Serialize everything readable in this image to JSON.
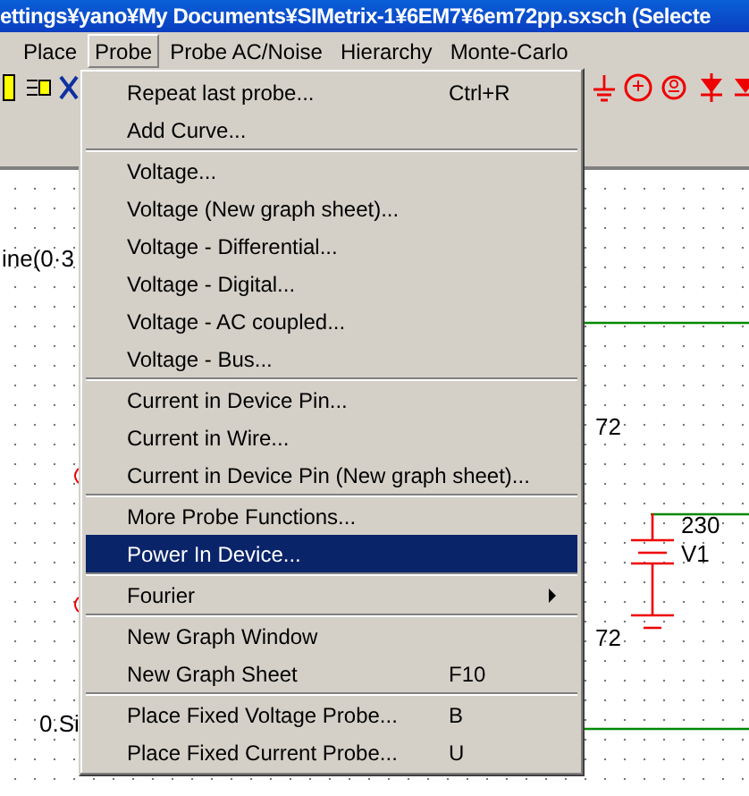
{
  "window": {
    "title": "ettings¥yano¥My Documents¥SIMetrix-1¥6EM7¥6em72pp.sxsch (Selecte"
  },
  "menubar": [
    {
      "label": "Place",
      "selected": false
    },
    {
      "label": "Probe",
      "selected": true
    },
    {
      "label": "Probe AC/Noise",
      "selected": false
    },
    {
      "label": "Hierarchy",
      "selected": false
    },
    {
      "label": "Monte-Carlo",
      "selected": false
    }
  ],
  "menu": {
    "items": [
      {
        "kind": "item",
        "label": "Repeat last probe...",
        "shortcut": "Ctrl+R",
        "selected": false
      },
      {
        "kind": "item",
        "label": "Add Curve...",
        "selected": false
      },
      {
        "kind": "separator"
      },
      {
        "kind": "item",
        "label": "Voltage...",
        "selected": false
      },
      {
        "kind": "item",
        "label": "Voltage (New graph sheet)...",
        "selected": false
      },
      {
        "kind": "item",
        "label": "Voltage - Differential...",
        "selected": false
      },
      {
        "kind": "item",
        "label": "Voltage - Digital...",
        "selected": false
      },
      {
        "kind": "item",
        "label": "Voltage - AC coupled...",
        "selected": false
      },
      {
        "kind": "item",
        "label": "Voltage - Bus...",
        "selected": false
      },
      {
        "kind": "separator"
      },
      {
        "kind": "item",
        "label": "Current in Device Pin...",
        "selected": false
      },
      {
        "kind": "item",
        "label": "Current in Wire...",
        "selected": false
      },
      {
        "kind": "item",
        "label": "Current in Device Pin (New graph sheet)...",
        "selected": false
      },
      {
        "kind": "separator"
      },
      {
        "kind": "item",
        "label": "More Probe Functions...",
        "selected": false
      },
      {
        "kind": "item",
        "label": "Power In Device...",
        "selected": true
      },
      {
        "kind": "separator"
      },
      {
        "kind": "submenu",
        "label": "Fourier",
        "selected": false
      },
      {
        "kind": "separator"
      },
      {
        "kind": "item",
        "label": "New Graph Window",
        "selected": false
      },
      {
        "kind": "item",
        "label": "New Graph Sheet",
        "shortcut": "F10",
        "selected": false
      },
      {
        "kind": "separator"
      },
      {
        "kind": "item",
        "label": "Place Fixed Voltage Probe...",
        "shortcut": "B",
        "selected": false
      },
      {
        "kind": "item",
        "label": "Place Fixed Current Probe...",
        "shortcut": "U",
        "selected": false
      }
    ]
  },
  "schematic": {
    "labels": [
      {
        "text": "ine(0·3"
      },
      {
        "text": "72"
      },
      {
        "text": "72"
      },
      {
        "text": "0.Si"
      }
    ],
    "source": {
      "value": "230",
      "name": "V1"
    }
  }
}
